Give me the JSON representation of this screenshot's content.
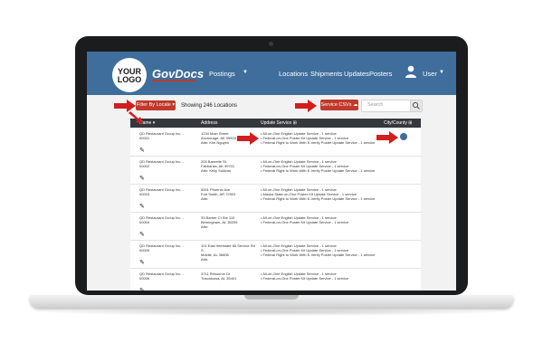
{
  "logo": {
    "line1": "YOUR",
    "line2": "LOGO"
  },
  "brand": "GovDocs",
  "nav": {
    "postings": "Postings",
    "links": [
      "Locations",
      "Shipments",
      "Updates",
      "Posters"
    ],
    "user": "User"
  },
  "toolbar": {
    "filter_label": "Filter By Locale",
    "showing": "Showing 246 Locations",
    "service_csv": "Service CSVs",
    "search_placeholder": "Search"
  },
  "table": {
    "headers": [
      "Name",
      "Address",
      "Update Service",
      "City/County"
    ],
    "rows": [
      {
        "name": [
          "QD Restaurant Group Inc. -",
          "00001"
        ],
        "address": [
          "1234 Main Street",
          "Anchorage, AK 99503",
          "",
          "Attn: Kim Nguyen"
        ],
        "services": [
          "All-on-One English Update Service - 1 service",
          "Federal-on-One Poster Kit Update Service - 1 service",
          "Federal Right to Work With E-Verify Poster Update Service - 1 service"
        ]
      },
      {
        "name": [
          "QD Restaurant Group Inc. -",
          "00002"
        ],
        "address": [
          "205 Barnette St.",
          "Fairbanks, AK 99701",
          "",
          "Attn: Kelly Sullivan"
        ],
        "services": [
          "All-on-One English Update Service - 1 service",
          "Federal-on-One Poster Kit Update Service - 1 service",
          "Federal Right to Work With E-Verify Poster Update Service - 1 service"
        ]
      },
      {
        "name": [
          "QD Restaurant Group Inc. -",
          "00003"
        ],
        "address": [
          "4001 Phoenix Ave",
          "Fort Smith, AR 72903",
          "",
          "Attn:"
        ],
        "services": [
          "All-on-One English Update Service - 1 service",
          "Alaska State-on-One Poster Kit Update Service - 1 service",
          "Federal Right to Work With E-Verify Poster Update Service - 1 service"
        ]
      },
      {
        "name": [
          "QD Restaurant Group Inc. -",
          "00004"
        ],
        "address": [
          "33 Barber Ct Ste 110",
          "Birmingham, AL 35209",
          "",
          "Attn:"
        ],
        "services": [
          "All-on-One English Update Service - 1 service",
          "Federal-on-One Poster Kit Update Service - 1 service"
        ]
      },
      {
        "name": [
          "QD Restaurant Group Inc. -",
          "00005"
        ],
        "address": [
          "101 East Interstate 65 Service Rd",
          "S",
          "Mobile, AL 36606",
          "",
          "Attn:"
        ],
        "services": [
          "All-on-One English Update Service - 1 service",
          "Federal-on-One Poster Kit Update Service - 1 service",
          "Federal Right to Work With E-Verify Poster Update Service - 1 service"
        ]
      },
      {
        "name": [
          "QD Restaurant Group Inc. -",
          "00006"
        ],
        "address": [
          "3711 Resource Dr",
          "Tuscaloosa, AL 35401"
        ],
        "services": [
          "All-on-One English Update Service - 1 service",
          "Federal-on-One Poster Kit Update Service - 1 service"
        ]
      }
    ]
  },
  "colors": {
    "nav": "#3f6e9c",
    "accent_red": "#c0392b",
    "table_head": "#34383c"
  }
}
